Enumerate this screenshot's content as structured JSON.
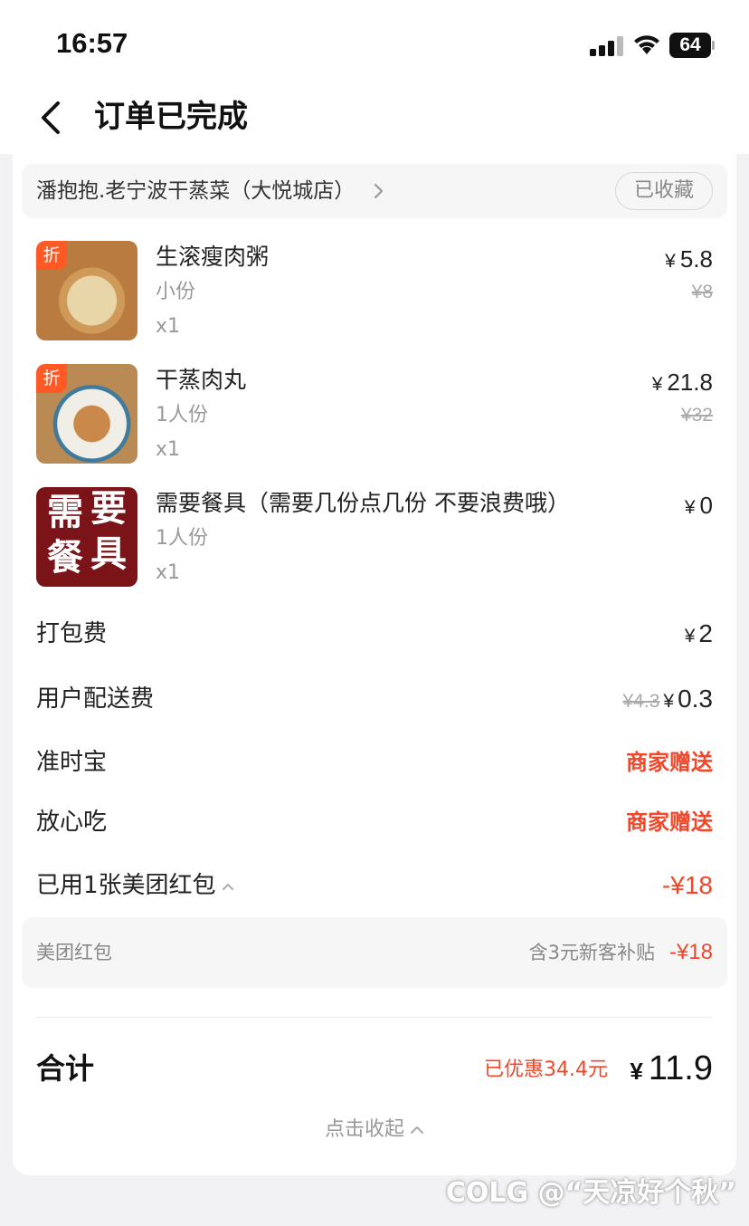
{
  "status_bar": {
    "time": "16:57",
    "battery": "64"
  },
  "nav": {
    "title": "订单已完成"
  },
  "shop": {
    "name": "潘抱抱.老宁波干蒸菜（大悦城店）",
    "fav_label": "已收藏"
  },
  "currency": "¥",
  "items": [
    {
      "badge": "折",
      "name": "生滚瘦肉粥",
      "spec": "小份",
      "qty": "x1",
      "price": "5.8",
      "original_price": "¥8"
    },
    {
      "badge": "折",
      "name": "干蒸肉丸",
      "spec": "1人份",
      "qty": "x1",
      "price": "21.8",
      "original_price": "¥32"
    },
    {
      "name": "需要餐具（需要几份点几份 不要浪费哦）",
      "spec": "1人份",
      "qty": "x1",
      "price": "0",
      "thumb_text": [
        "需",
        "要",
        "餐",
        "具"
      ]
    }
  ],
  "fees": {
    "packing": {
      "label": "打包费",
      "value": "2"
    },
    "delivery": {
      "label": "用户配送费",
      "original": "¥4.3",
      "value": "0.3"
    },
    "ontime": {
      "label": "准时宝",
      "value": "商家赠送"
    },
    "safe_eat": {
      "label": "放心吃",
      "value": "商家赠送"
    },
    "redpack": {
      "label": "已用1张美团红包",
      "value": "-¥18"
    }
  },
  "coupon": {
    "label": "美团红包",
    "note": "含3元新客补贴",
    "value": "-¥18"
  },
  "total": {
    "label": "合计",
    "saved": "已优惠34.4元",
    "value": "11.9"
  },
  "collapse_label": "点击收起",
  "watermark": "COLG @“天凉好个秋”",
  "colors": {
    "accent": "#f0472a",
    "badge": "#ff5a26"
  }
}
